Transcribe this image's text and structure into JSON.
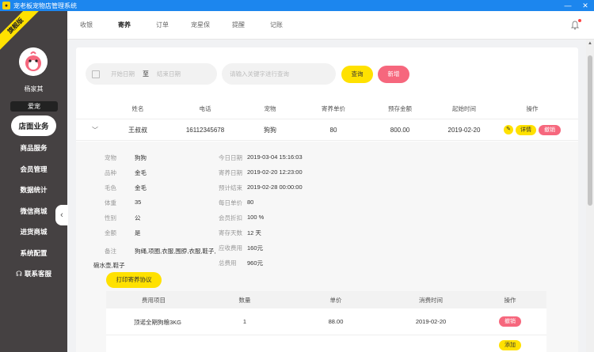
{
  "window": {
    "title": "宠老板宠物店管理系统"
  },
  "sidebar": {
    "version_badge": "旗舰版",
    "user_name": "杨家其",
    "user_role": "爱宠",
    "items": [
      {
        "label": "店面业务",
        "active": true
      },
      {
        "label": "商品服务"
      },
      {
        "label": "会员管理"
      },
      {
        "label": "数据统计"
      },
      {
        "label": "微信商城"
      },
      {
        "label": "进货商城"
      },
      {
        "label": "系统配置"
      },
      {
        "label": "联系客服"
      }
    ]
  },
  "tabs": [
    "收银",
    "寄养",
    "订单",
    "宠星保",
    "提醒",
    "记账"
  ],
  "filters": {
    "start_placeholder": "开始日期",
    "separator": "至",
    "end_placeholder": "结束日期",
    "search_placeholder": "请输入关键字进行查询",
    "query_label": "查询",
    "new_label": "新增"
  },
  "table": {
    "headers": [
      "姓名",
      "电话",
      "宠物",
      "寄养单价",
      "预存金额",
      "起始时间",
      "操作"
    ],
    "row": {
      "name": "王叔叔",
      "phone": "16112345678",
      "pet": "狗狗",
      "unit_price": "80",
      "deposit": "800.00",
      "start": "2019-02-20",
      "detail_label": "详情",
      "cancel_label": "撤销"
    }
  },
  "detail": {
    "left": [
      {
        "k": "宠物",
        "v": "狗狗"
      },
      {
        "k": "品种",
        "v": "金毛"
      },
      {
        "k": "毛色",
        "v": "金毛"
      },
      {
        "k": "体重",
        "v": "35"
      },
      {
        "k": "性别",
        "v": "公"
      },
      {
        "k": "金额",
        "v": "是"
      },
      {
        "k": "备注",
        "v": "狗绳,项圈,衣服,围脖,衣服,鞋子,"
      }
    ],
    "remark_continued": "碗水壶,鞋子",
    "right": [
      {
        "k": "今日日期",
        "v": "2019-03-04 15:16:03"
      },
      {
        "k": "寄养日期",
        "v": "2019-02-20 12:23:00"
      },
      {
        "k": "预计结束",
        "v": "2019-02-28 00:00:00"
      },
      {
        "k": "每日单价",
        "v": "80"
      },
      {
        "k": "会员折扣",
        "v": "100 %"
      },
      {
        "k": "寄存天数",
        "v": "12 天"
      },
      {
        "k": "应收费用",
        "v": "160元"
      },
      {
        "k": "总费用",
        "v": "960元"
      }
    ],
    "print_label": "打印寄养协议"
  },
  "fees": {
    "headers": [
      "费用项目",
      "数量",
      "单价",
      "消费时间",
      "操作"
    ],
    "rows": [
      {
        "item": "顶诺全期狗粮3KG",
        "qty": "1",
        "price": "88.00",
        "time": "2019-02-20",
        "cancel_label": "撤销"
      }
    ],
    "add_label": "添加"
  }
}
